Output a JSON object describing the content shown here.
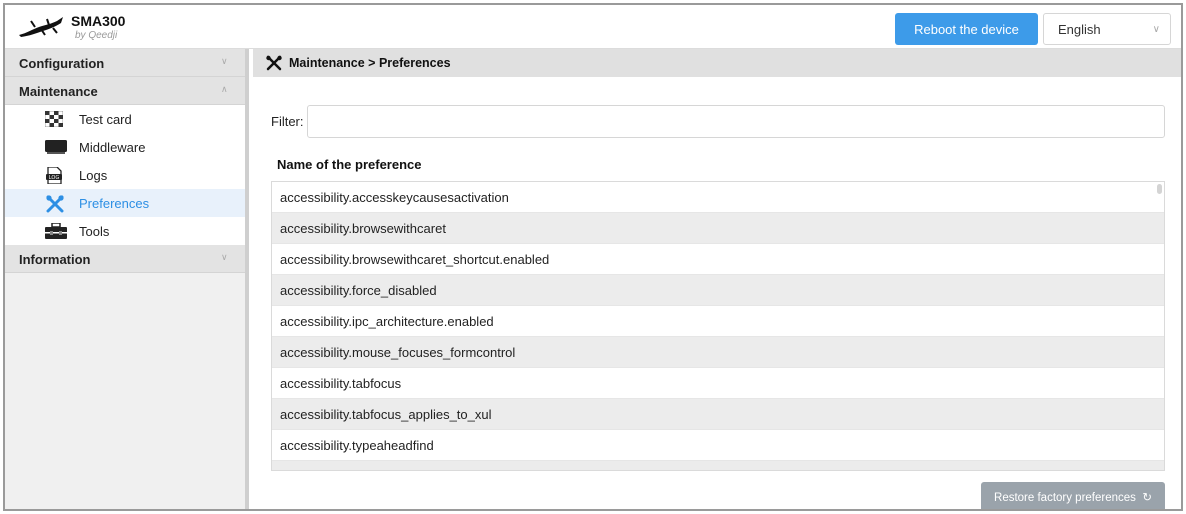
{
  "header": {
    "app_name": "SMA300",
    "app_subtitle": "by Qeedji",
    "reboot_label": "Reboot the device",
    "language": "English",
    "logo_icon": "lizard-logo-icon"
  },
  "sidebar": {
    "sections": [
      {
        "label": "Configuration",
        "expanded": false
      },
      {
        "label": "Maintenance",
        "expanded": true
      },
      {
        "label": "Information",
        "expanded": false
      }
    ],
    "maintenance_items": [
      {
        "label": "Test card",
        "icon": "checkerboard-icon",
        "active": false
      },
      {
        "label": "Middleware",
        "icon": "monitor-icon",
        "active": false
      },
      {
        "label": "Logs",
        "icon": "log-file-icon",
        "active": false
      },
      {
        "label": "Preferences",
        "icon": "tools-cross-icon",
        "active": true
      },
      {
        "label": "Tools",
        "icon": "toolbox-icon",
        "active": false
      }
    ],
    "accent_color": "#2d8fe4"
  },
  "main": {
    "breadcrumb": "Maintenance > Preferences",
    "breadcrumb_icon": "tools-cross-icon",
    "filter_label": "Filter:",
    "filter_value": "",
    "column_header": "Name of the preference",
    "preferences": [
      "accessibility.accesskeycausesactivation",
      "accessibility.browsewithcaret",
      "accessibility.browsewithcaret_shortcut.enabled",
      "accessibility.force_disabled",
      "accessibility.ipc_architecture.enabled",
      "accessibility.mouse_focuses_formcontrol",
      "accessibility.tabfocus",
      "accessibility.tabfocus_applies_to_xul",
      "accessibility.typeaheadfind"
    ],
    "restore_label": "Restore factory preferences",
    "restore_icon": "refresh-icon"
  }
}
